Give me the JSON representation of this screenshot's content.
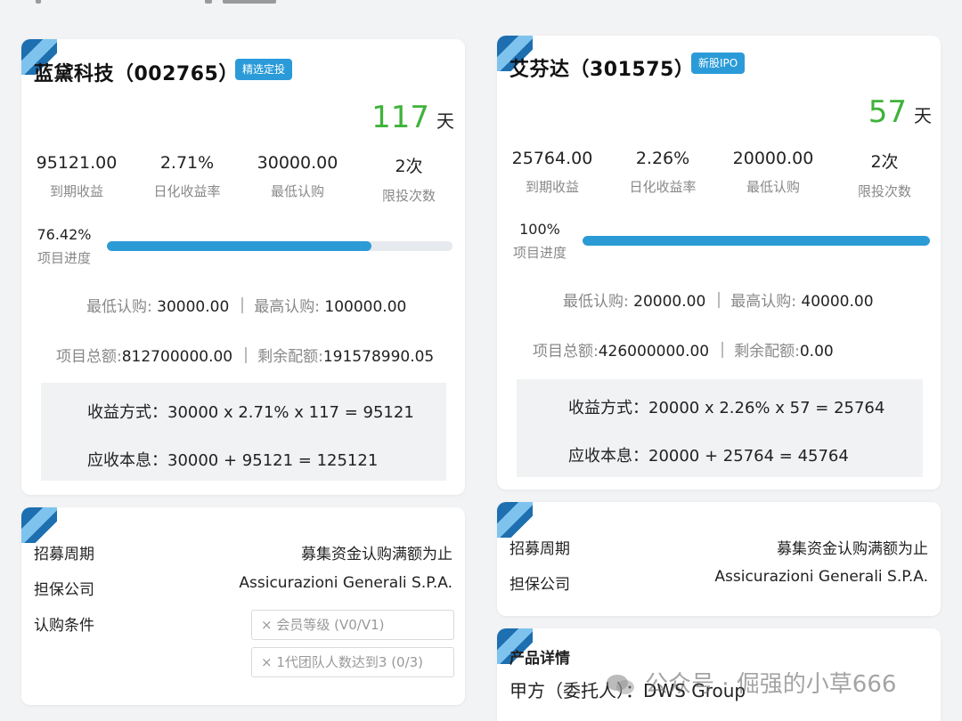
{
  "left": {
    "title": "蓝黛科技（002765）",
    "tag": "精选定投",
    "days_value": "117",
    "days_unit": "天",
    "stats": [
      {
        "value": "95121.00",
        "label": "到期收益"
      },
      {
        "value": "2.71%",
        "label": "日化收益率"
      },
      {
        "value": "30000.00",
        "label": "最低认购"
      },
      {
        "value": "2次",
        "label": "限投次数"
      }
    ],
    "progress_text": "76.42%",
    "progress_fraction": 0.7642,
    "progress_label": "项目进度",
    "min_label": "最低认购: ",
    "min_value": "30000.00",
    "max_label": "最高认购: ",
    "max_value": "100000.00",
    "total_label": "项目总额:",
    "total_value": "812700000.00",
    "remain_label": "剩余配额:",
    "remain_value": "191578990.05",
    "formula_income": "收益方式：30000 x 2.71% x 117 = 95121",
    "formula_total": "应收本息：30000 + 95121 = 125121"
  },
  "right": {
    "title": "艾芬达（301575）",
    "tag": "新股IPO",
    "days_value": "57",
    "days_unit": "天",
    "stats": [
      {
        "value": "25764.00",
        "label": "到期收益"
      },
      {
        "value": "2.26%",
        "label": "日化收益率"
      },
      {
        "value": "20000.00",
        "label": "最低认购"
      },
      {
        "value": "2次",
        "label": "限投次数"
      }
    ],
    "progress_text": "100%",
    "progress_fraction": 1.0,
    "progress_label": "项目进度",
    "min_label": "最低认购: ",
    "min_value": "20000.00",
    "max_label": "最高认购: ",
    "max_value": "40000.00",
    "total_label": "项目总额:",
    "total_value": "426000000.00",
    "remain_label": "剩余配额:",
    "remain_value": "0.00",
    "formula_income": "收益方式：20000 x 2.26% x 57 = 25764",
    "formula_total": "应收本息：20000 + 25764 = 45764"
  },
  "left_info": {
    "period_label": "招募周期",
    "period_value": "募集资金认购满额为止",
    "guarantor_label": "担保公司",
    "guarantor_value": "Assicurazioni Generali S.P.A.",
    "condition_label": "认购条件",
    "conditions": [
      "× 会员等级 (V0/V1)",
      "× 1代团队人数达到3   (0/3)"
    ]
  },
  "right_info": {
    "period_label": "招募周期",
    "period_value": "募集资金认购满额为止",
    "guarantor_label": "担保公司",
    "guarantor_value": "Assicurazioni Generali S.P.A."
  },
  "product": {
    "heading": "产品详情",
    "party_a": "甲方（委托人）：DWS Group"
  },
  "watermark": "公众号 · 倔强的小草666",
  "colors": {
    "accent": "#2b9bd6",
    "days": "#3fb23a"
  }
}
